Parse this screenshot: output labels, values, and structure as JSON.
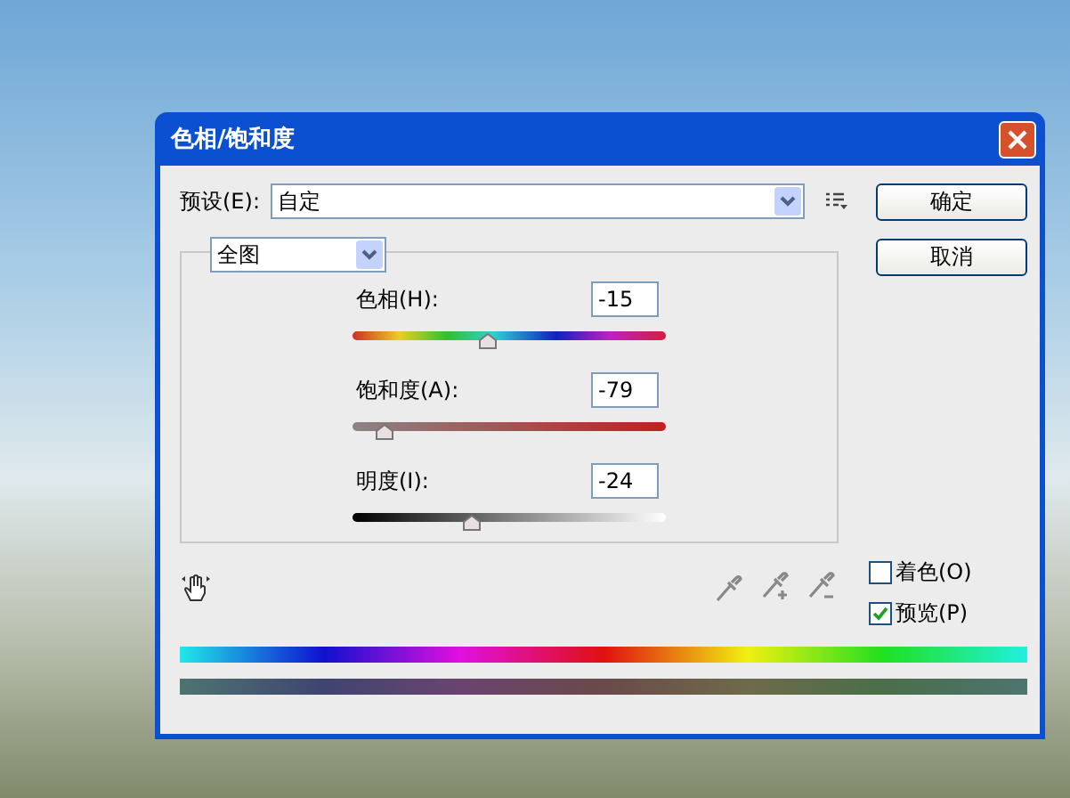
{
  "window": {
    "title": "色相/饱和度"
  },
  "preset": {
    "label": "预设(E):",
    "value": "自定"
  },
  "buttons": [
    {
      "label": "确定"
    },
    {
      "label": "取消"
    }
  ],
  "edit": {
    "value": "全图"
  },
  "adjustments": [
    {
      "kind": "hue",
      "label": "色相(H):",
      "value": "-15",
      "level": 0.43
    },
    {
      "kind": "saturation",
      "label": "饱和度(A):",
      "value": "-79",
      "level": 0.1
    },
    {
      "kind": "lightness",
      "label": "明度(I):",
      "value": "-24",
      "level": 0.38
    }
  ],
  "options": [
    {
      "label": "着色(O)",
      "checked": false
    },
    {
      "label": "预览(P)",
      "checked": true
    }
  ]
}
